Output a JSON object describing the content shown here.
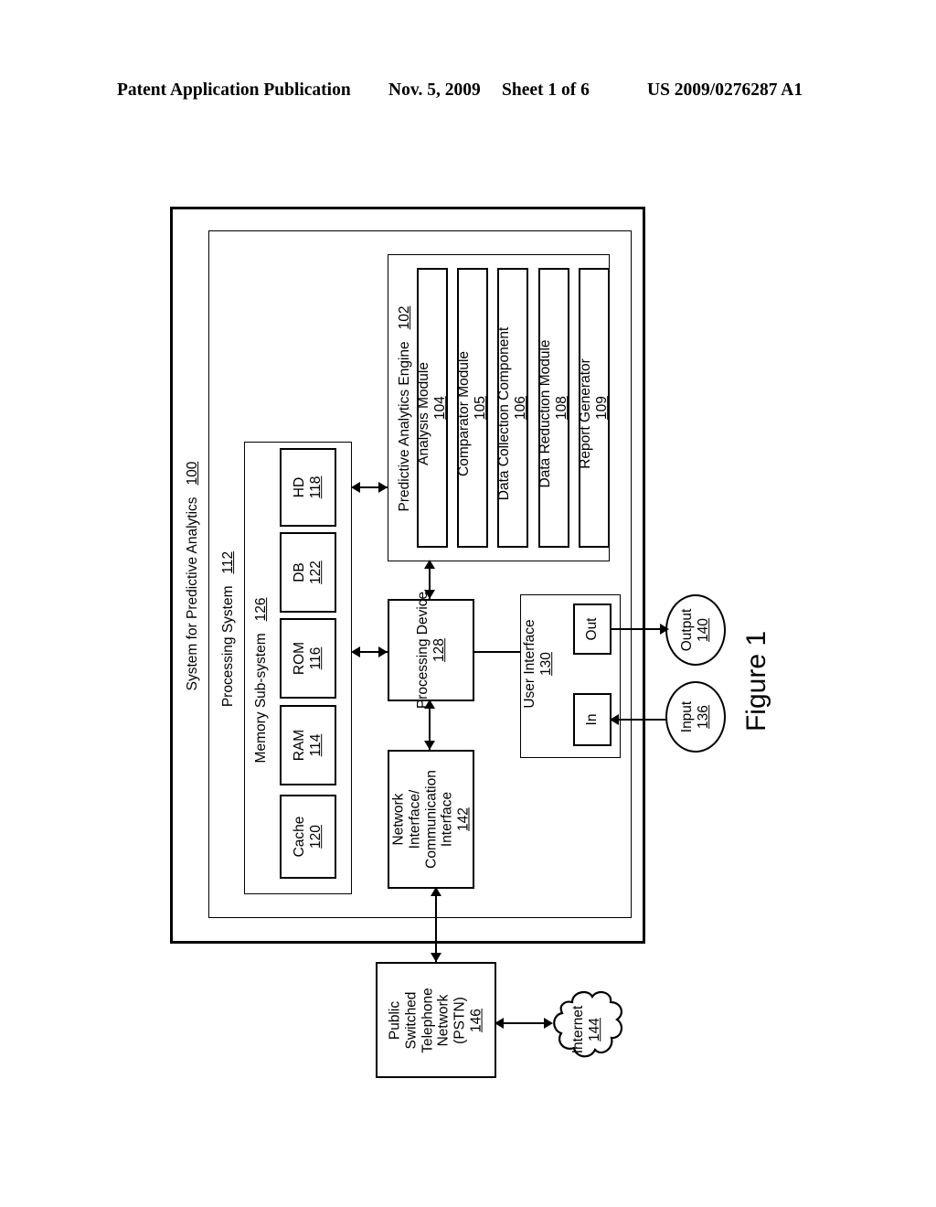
{
  "header": {
    "publication": "Patent Application Publication",
    "date": "Nov. 5, 2009",
    "sheet": "Sheet 1 of 6",
    "patent_number": "US 2009/0276287 A1"
  },
  "figure": {
    "caption": "Figure 1"
  },
  "diagram": {
    "outer_system": {
      "label": "System for Predictive Analytics",
      "ref": "100"
    },
    "processing_system": {
      "label": "Processing System",
      "ref": "112"
    },
    "memory_subsystem": {
      "label": "Memory Sub-system",
      "ref": "126",
      "items": [
        {
          "label": "Cache",
          "ref": "120"
        },
        {
          "label": "RAM",
          "ref": "114"
        },
        {
          "label": "ROM",
          "ref": "116"
        },
        {
          "label": "DB",
          "ref": "122"
        },
        {
          "label": "HD",
          "ref": "118"
        }
      ]
    },
    "predictive_analytics_engine": {
      "label": "Predictive Analytics Engine",
      "ref": "102",
      "modules": [
        {
          "label": "Analysis Module",
          "ref": "104"
        },
        {
          "label": "Comparator Module",
          "ref": "105"
        },
        {
          "label": "Data Collection Component",
          "ref": "106"
        },
        {
          "label": "Data Reduction Module",
          "ref": "108"
        },
        {
          "label": "Report Generator",
          "ref": "109"
        }
      ]
    },
    "processing_device": {
      "label": "Processing Device",
      "ref": "128"
    },
    "network_interface": {
      "label": "Network Interface/ Communication Interface",
      "line1": "Network",
      "line2": "Interface/",
      "line3": "Communication",
      "line4": "Interface",
      "ref": "142"
    },
    "user_interface": {
      "label": "User Interface",
      "ref": "130",
      "out_label": "Out",
      "in_label": "In"
    },
    "output_node": {
      "label": "Output",
      "ref": "140"
    },
    "input_node": {
      "label": "Input",
      "ref": "136"
    },
    "pstn": {
      "line1": "Public",
      "line2": "Switched",
      "line3": "Telephone",
      "line4": "Network",
      "line5": "(PSTN)",
      "ref": "146"
    },
    "internet": {
      "label": "Internet",
      "ref": "144"
    }
  }
}
